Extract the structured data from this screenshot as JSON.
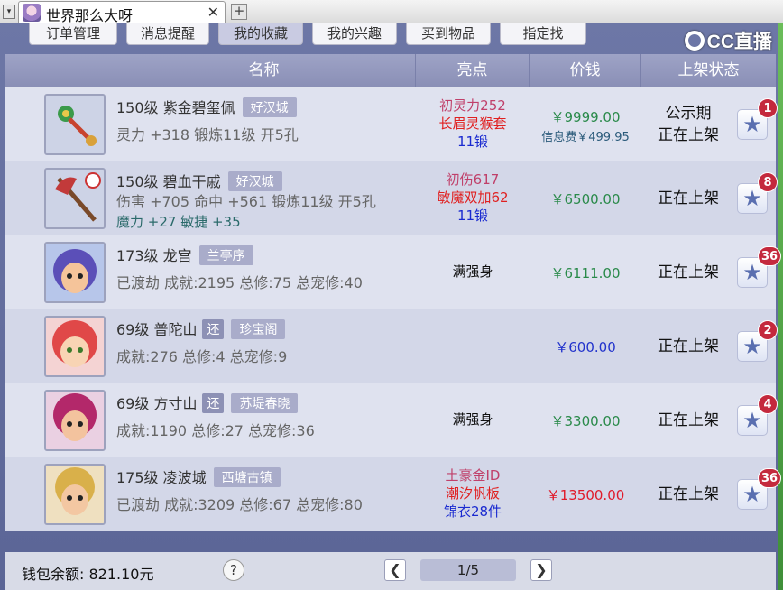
{
  "window": {
    "menu_glyph": "▾",
    "tab_title": "世界那么大呀",
    "close_glyph": "✕",
    "new_tab_glyph": "+"
  },
  "top_tabs": [
    "订单管理",
    "消息提醒",
    "我的收藏",
    "我的兴趣",
    "买到物品",
    "指定找"
  ],
  "brand": "CC直播",
  "columns": {
    "name": "名称",
    "highlight": "亮点",
    "price": "价钱",
    "status": "上架状态"
  },
  "items": [
    {
      "avatar_icon": "jade-pendant-item-icon",
      "level_name": "150级 紫金碧玺佩",
      "server": "好汉城",
      "extra_tag": "",
      "line2": "灵力 +318 锻炼11级 开5孔",
      "line3": "",
      "highlights": [
        {
          "text": "初灵力252",
          "color": "#c0406a"
        },
        {
          "text": "长眉灵猴套",
          "color": "#e02020"
        },
        {
          "text": "11锻",
          "color": "#1a2ad0"
        }
      ],
      "price": "￥9999.00",
      "price_color": "#2a8a4a",
      "fee": "信息费￥499.95",
      "status_lines": [
        "公示期",
        "正在上架"
      ],
      "fav_count": "1"
    },
    {
      "avatar_icon": "axe-weapon-item-icon",
      "level_name": "150级 碧血干戚",
      "server": "好汉城",
      "extra_tag": "",
      "line2": "伤害 +705 命中 +561 锻炼11级 开5孔",
      "line3": "魔力 +27 敏捷 +35",
      "highlights": [
        {
          "text": "初伤617",
          "color": "#c0406a"
        },
        {
          "text": "敏魔双加62",
          "color": "#e02020"
        },
        {
          "text": "11锻",
          "color": "#1a2ad0"
        }
      ],
      "price": "￥6500.00",
      "price_color": "#2a8a4a",
      "fee": "",
      "status_lines": [
        "正在上架"
      ],
      "fav_count": "8"
    },
    {
      "avatar_icon": "longgong-character-avatar",
      "level_name": "173级 龙宫",
      "server": "兰亭序",
      "extra_tag": "",
      "line2": "已渡劫 成就:2195 总修:75 总宠修:40",
      "line3": "",
      "highlights": [
        {
          "text": "满强身",
          "color": "#111111"
        }
      ],
      "price": "￥6111.00",
      "price_color": "#2a8a4a",
      "fee": "",
      "status_lines": [
        "正在上架"
      ],
      "fav_count": "36"
    },
    {
      "avatar_icon": "putuoshan-character-avatar",
      "level_name": "69级 普陀山",
      "server": "珍宝阁",
      "extra_tag": "还",
      "line2": "成就:276 总修:4 总宠修:9",
      "line3": "",
      "highlights": [],
      "price": "￥600.00",
      "price_color": "#2233cc",
      "fee": "",
      "status_lines": [
        "正在上架"
      ],
      "fav_count": "2"
    },
    {
      "avatar_icon": "fangcunshan-character-avatar",
      "level_name": "69级 方寸山",
      "server": "苏堤春晓",
      "extra_tag": "还",
      "line2": "成就:1190 总修:27 总宠修:36",
      "line3": "",
      "highlights": [
        {
          "text": "满强身",
          "color": "#111111"
        }
      ],
      "price": "￥3300.00",
      "price_color": "#2a8a4a",
      "fee": "",
      "status_lines": [
        "正在上架"
      ],
      "fav_count": "4"
    },
    {
      "avatar_icon": "lingbocheng-character-avatar",
      "level_name": "175级 凌波城",
      "server": "西塘古镇",
      "extra_tag": "",
      "line2": "已渡劫 成就:3209 总修:67 总宠修:80",
      "line3": "",
      "highlights": [
        {
          "text": "土豪金ID",
          "color": "#c0406a"
        },
        {
          "text": "潮汐帆板",
          "color": "#e02020"
        },
        {
          "text": "锦衣28件",
          "color": "#1a2ad0"
        }
      ],
      "price": "￥13500.00",
      "price_color": "#e01a2a",
      "fee": "",
      "status_lines": [
        "正在上架"
      ],
      "fav_count": "36"
    }
  ],
  "footer": {
    "wallet_label": "钱包余额: 821.10元",
    "help_glyph": "?",
    "prev_glyph": "❮",
    "next_glyph": "❯",
    "page": "1/5"
  }
}
